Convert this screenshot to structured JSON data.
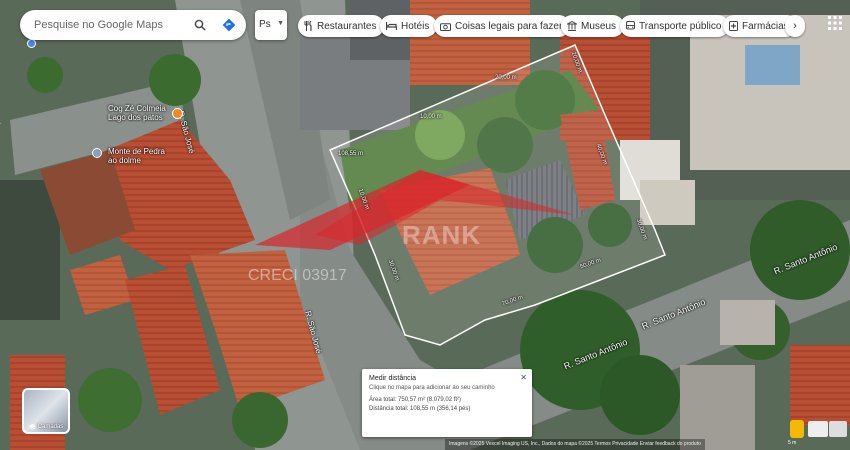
{
  "search": {
    "placeholder": "Pesquise no Google Maps"
  },
  "select_text": "Ps",
  "chips": [
    {
      "label": "Restaurantes",
      "icon": "fork-knife-icon"
    },
    {
      "label": "Hotéis",
      "icon": "bed-icon"
    },
    {
      "label": "Coisas legais para fazer",
      "icon": "camera-icon"
    },
    {
      "label": "Museus",
      "icon": "museum-icon"
    },
    {
      "label": "Transporte público",
      "icon": "bus-icon"
    },
    {
      "label": "Farmácias",
      "icon": "pill-icon"
    }
  ],
  "places": [
    {
      "name_line1": "Cog Zé Colmeia",
      "name_line2": "Lago dos patos"
    },
    {
      "name_line1": "Monte de Pedra",
      "name_line2": "ao dolme"
    }
  ],
  "streets": {
    "sao_jose": "R. São José",
    "santo_antonio": "R. Santo Antônio"
  },
  "measure_labels": [
    "20,00 m",
    "20,00 m",
    "10,00 m",
    "108,55 m",
    "40,00 m",
    "10,00 m",
    "30,00 m",
    "50,00 m",
    "70,00 m",
    "30,00 m"
  ],
  "watermark": {
    "brand": "RANK",
    "creci": "CRECI 03917"
  },
  "measure": {
    "title": "Medir distância",
    "hint": "Clique no mapa para adicionar ao seu caminho",
    "area": "Área total: 750,57 m² (8.079,02 ft²)",
    "distance": "Distância total: 108,55 m (356,14 pés)"
  },
  "layers_label": "Camadas",
  "attribution": "Imagens ©2025 Vexcel Imaging US, Inc., Dados do mapa ©2025   Termos   Privacidade   Enviar feedback do produto",
  "scale": "5 m",
  "colors": {
    "measure_line": "#ffffff",
    "watermark_red": "#d9262b"
  }
}
